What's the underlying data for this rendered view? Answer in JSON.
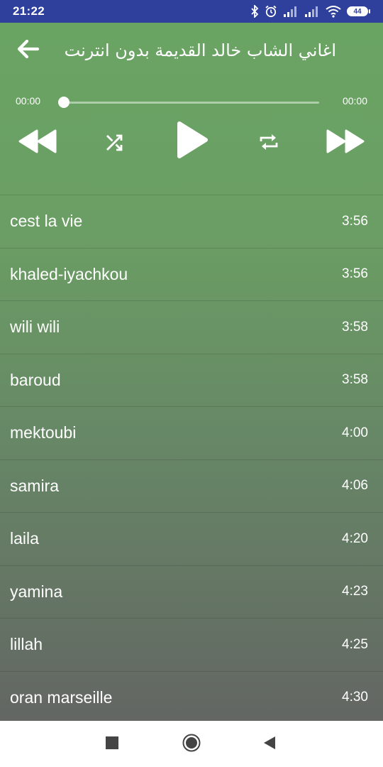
{
  "status_bar": {
    "time": "21:22",
    "battery": "44",
    "icons": [
      "bluetooth-icon",
      "alarm-icon",
      "signal-icon",
      "signal-icon",
      "wifi-icon",
      "battery-icon"
    ]
  },
  "toolbar": {
    "title": "اغاني الشاب خالد القديمة بدون انترنت",
    "back_icon": "arrow-back-icon"
  },
  "player": {
    "elapsed": "00:00",
    "total": "00:00",
    "progress": 0,
    "controls": [
      "rewind-icon",
      "shuffle-icon",
      "play-icon",
      "repeat-icon",
      "fast-forward-icon"
    ]
  },
  "songs": [
    {
      "title": "cest la vie",
      "duration": "3:56"
    },
    {
      "title": "khaled-iyachkou",
      "duration": "3:56"
    },
    {
      "title": "wili wili",
      "duration": "3:58"
    },
    {
      "title": "baroud",
      "duration": "3:58"
    },
    {
      "title": "mektoubi",
      "duration": "4:00"
    },
    {
      "title": "samira",
      "duration": "4:06"
    },
    {
      "title": "laila",
      "duration": "4:20"
    },
    {
      "title": "yamina",
      "duration": "4:23"
    },
    {
      "title": "lillah",
      "duration": "4:25"
    },
    {
      "title": "oran marseille",
      "duration": "4:30"
    }
  ],
  "colors": {
    "status_bar": "#2f3f9c",
    "app_top": "#6aa463",
    "app_bottom": "#636663",
    "text": "#ffffff"
  },
  "nav_bar": {
    "buttons": [
      "recents-square-icon",
      "home-circle-icon",
      "back-triangle-icon"
    ]
  }
}
